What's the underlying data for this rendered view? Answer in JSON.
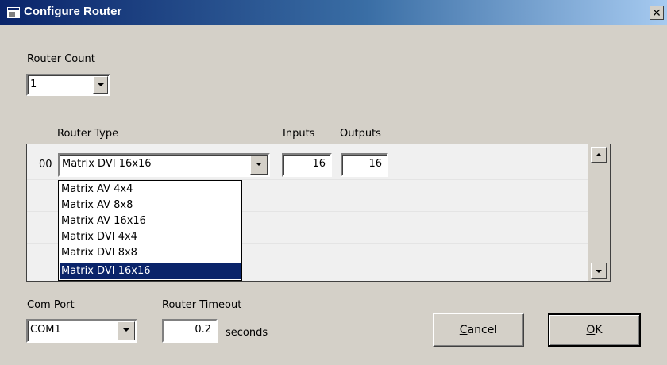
{
  "window": {
    "title": "Configure Router",
    "close_label": "✕"
  },
  "router_count": {
    "label": "Router Count",
    "value": "1"
  },
  "grid": {
    "header_router_type": "Router Type",
    "header_inputs": "Inputs",
    "header_outputs": "Outputs",
    "rows": [
      {
        "index": "00",
        "type": "Matrix DVI 16x16",
        "inputs": "16",
        "outputs": "16"
      }
    ]
  },
  "router_type_dropdown": {
    "options": [
      "Matrix AV 4x4",
      "Matrix AV 8x8",
      "Matrix AV 16x16",
      "Matrix DVI 4x4",
      "Matrix DVI 8x8",
      "Matrix DVI 16x16"
    ],
    "selected": "Matrix DVI 16x16"
  },
  "com_port": {
    "label": "Com Port",
    "value": "COM1"
  },
  "router_timeout": {
    "label": "Router Timeout",
    "value": "0.2",
    "unit": "seconds"
  },
  "buttons": {
    "cancel": {
      "mnemonic": "C",
      "rest": "ancel"
    },
    "ok": {
      "mnemonic": "O",
      "rest": "K"
    }
  }
}
